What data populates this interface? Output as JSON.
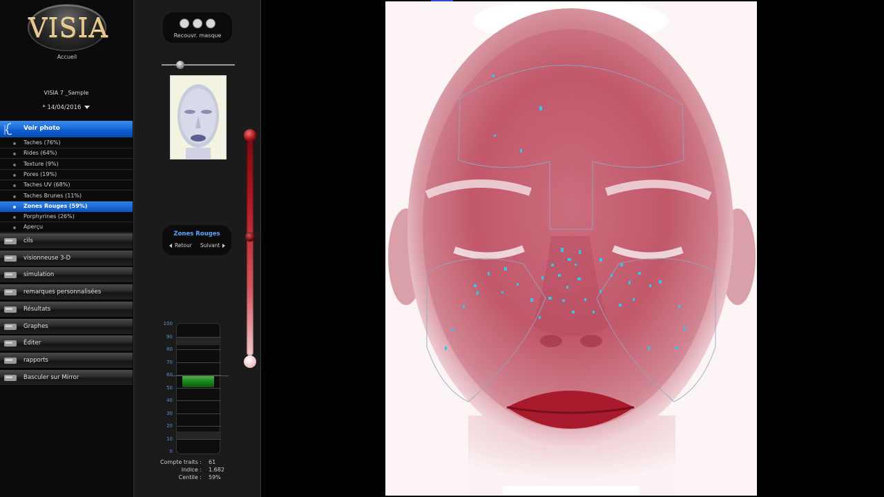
{
  "app": {
    "logo": "VISIA",
    "home_label": "Accueil",
    "patient_name": "VISIA 7 _Sample",
    "visit_date": "* 14/04/2016"
  },
  "sidebar": {
    "active_section": "Voir photo",
    "analyses": [
      {
        "label": "Taches (76%)",
        "selected": false
      },
      {
        "label": "Rides (64%)",
        "selected": false
      },
      {
        "label": "Texture (9%)",
        "selected": false
      },
      {
        "label": "Pores (19%)",
        "selected": false
      },
      {
        "label": "Taches UV (68%)",
        "selected": false
      },
      {
        "label": "Taches Brunes (11%)",
        "selected": false
      },
      {
        "label": "Zones Rouges (59%)",
        "selected": true
      },
      {
        "label": "Porphyrines  (26%)",
        "selected": false
      },
      {
        "label": "Aperçu",
        "selected": false
      }
    ],
    "tools": [
      {
        "label": "cils",
        "icon": "eyelash-icon"
      },
      {
        "label": "visionneuse 3-D",
        "icon": "viewer-3d-icon"
      },
      {
        "label": "simulation",
        "icon": "simulation-icon"
      },
      {
        "label": "remarques personnalisées",
        "icon": "notes-icon"
      },
      {
        "label": "Résultats",
        "icon": "results-icon"
      },
      {
        "label": "Graphes",
        "icon": "graph-icon"
      },
      {
        "label": "Éditer",
        "icon": "edit-icon"
      },
      {
        "label": "rapports",
        "icon": "printer-icon"
      },
      {
        "label": "Basculer sur Mirror",
        "icon": "mirror-icon"
      }
    ]
  },
  "panel": {
    "mask_label": "Recouvr. masque",
    "nav_title": "Zones Rouges",
    "nav_prev": "Retour",
    "nav_next": "Suivant",
    "gauge_ticks": [
      "100",
      "90",
      "80",
      "70",
      "60",
      "50",
      "40",
      "30",
      "20",
      "10",
      "0"
    ],
    "gauge_value": 59,
    "stats": [
      {
        "label": "Compte traits :",
        "value": "61"
      },
      {
        "label": "Indice :",
        "value": "1.682"
      },
      {
        "label": "Centile :",
        "value": "59%"
      }
    ]
  },
  "colors": {
    "accent_blue": "#0d5fd0",
    "highlight_red": "#b51820",
    "spot_cyan": "#2ec8e8",
    "gauge_green": "#1c8a20"
  }
}
